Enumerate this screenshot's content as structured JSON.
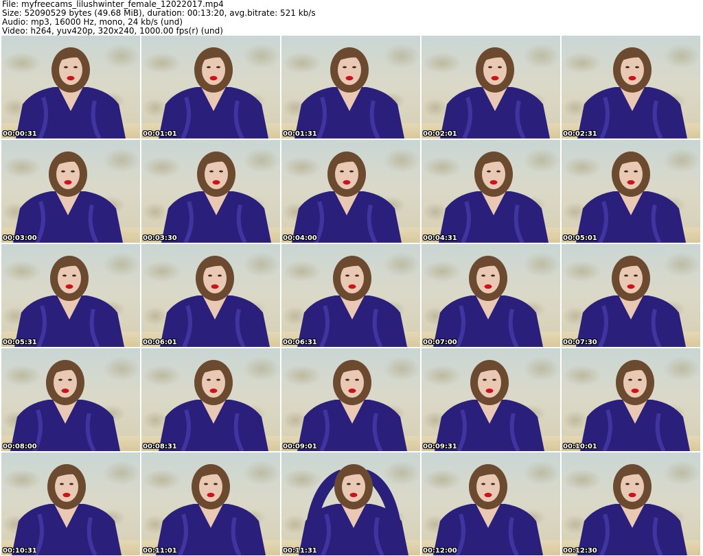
{
  "header": {
    "file_line": "File: myfreecams_lilushwinter_female_12022017.mp4",
    "size_line": "Size: 52090529 bytes (49.68 MiB), duration: 00:13:20, avg.bitrate: 521 kb/s",
    "audio_line": "Audio: mp3, 16000 Hz, mono, 24 kb/s (und)",
    "video_line": "Video: h264, yuv420p, 320x240, 1000.00 fps(r) (und)"
  },
  "thumbnails": [
    {
      "timestamp": "00:00:31"
    },
    {
      "timestamp": "00:01:01"
    },
    {
      "timestamp": "00:01:31"
    },
    {
      "timestamp": "00:02:01"
    },
    {
      "timestamp": "00:02:31"
    },
    {
      "timestamp": "00:03:00"
    },
    {
      "timestamp": "00:03:30"
    },
    {
      "timestamp": "00:04:00"
    },
    {
      "timestamp": "00:04:31"
    },
    {
      "timestamp": "00:05:01"
    },
    {
      "timestamp": "00:05:31"
    },
    {
      "timestamp": "00:06:01"
    },
    {
      "timestamp": "00:06:31"
    },
    {
      "timestamp": "00:07:00"
    },
    {
      "timestamp": "00:07:30"
    },
    {
      "timestamp": "00:08:00"
    },
    {
      "timestamp": "00:08:31"
    },
    {
      "timestamp": "00:09:01"
    },
    {
      "timestamp": "00:09:31"
    },
    {
      "timestamp": "00:10:01"
    },
    {
      "timestamp": "00:10:31"
    },
    {
      "timestamp": "00:11:01"
    },
    {
      "timestamp": "00:11:31"
    },
    {
      "timestamp": "00:12:00"
    },
    {
      "timestamp": "00:12:30"
    }
  ],
  "colors": {
    "robe": "#2a1f7a",
    "robe_highlight": "#4a3fb0",
    "hair": "#6b4a30",
    "skin": "#e9c9b4",
    "lips": "#d0101a",
    "background_map": "#cfd8d2",
    "timestamp_text": "#ffffff"
  }
}
